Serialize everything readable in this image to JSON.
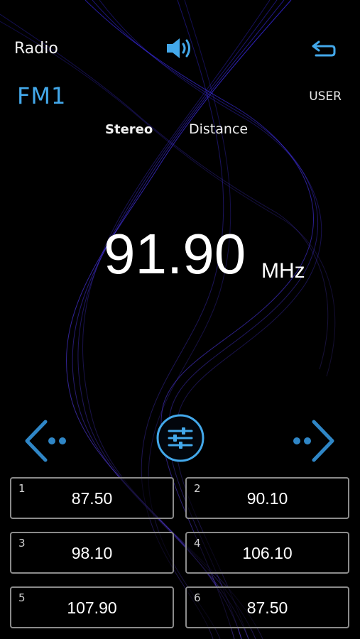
{
  "header": {
    "title": "Radio",
    "band": "FM1",
    "user_label": "USER",
    "volume_icon": "speaker-volume-icon",
    "back_icon": "return-arrow-icon"
  },
  "status": {
    "stereo": "Stereo",
    "distance": "Distance"
  },
  "tuner": {
    "frequency": "91.90",
    "unit": "MHz"
  },
  "controls": {
    "prev_icon": "seek-left-icon",
    "settings_icon": "equalizer-sliders-icon",
    "next_icon": "seek-right-icon"
  },
  "presets": [
    {
      "num": "1",
      "freq": "87.50"
    },
    {
      "num": "2",
      "freq": "90.10"
    },
    {
      "num": "3",
      "freq": "98.10"
    },
    {
      "num": "4",
      "freq": "106.10"
    },
    {
      "num": "5",
      "freq": "107.90"
    },
    {
      "num": "6",
      "freq": "87.50"
    }
  ],
  "colors": {
    "accent": "#43a8ea",
    "background": "#000000",
    "wave": "#4a3cff"
  }
}
